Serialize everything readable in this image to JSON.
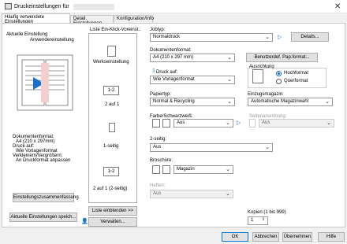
{
  "window": {
    "title": "Druckeinstellungen für"
  },
  "tabs": [
    "Häufig verwendete Einstellungen",
    "Detail. Einstellungen",
    "Konfiguration/Info"
  ],
  "left": {
    "current_label": "Aktuelle Einstellung",
    "current_name": "Anwendereinstellung",
    "summary": [
      "Dokumentenformat:",
      "A4 (210 x 297mm)",
      "Druck auf:",
      "Wie Vorlagenformat",
      "Verkleinern/Vergrößern:",
      "An Druckformat anpassen"
    ],
    "summary_button": "Einstellungszusammenfassung",
    "save_button": "Aktuelle Einstellungen speich..."
  },
  "oneclick": {
    "title": "Liste Ein-Klick-Voreinst.:",
    "items": [
      "Werkseinstellung",
      "2 auf 1",
      "1-seitig",
      "2 auf 1 (2-seitig)"
    ],
    "show_list": "Liste einblenden >>",
    "manage": "Verwalten..."
  },
  "settings": {
    "job_type": {
      "label": "Jobtyp:",
      "value": "Normaldruck",
      "details": "Details..."
    },
    "doc_size": {
      "label": "Dokumentenformat:",
      "value": "A4 (210 x 297 mm)",
      "custom": "Benutzerdef. Pap.format..."
    },
    "print_on": {
      "label": "Druck auf:",
      "value": "Wie Vorlagenformat"
    },
    "orientation": {
      "label": "Ausrichtung",
      "options": [
        "Hochformat",
        "Querformat"
      ],
      "selected": "Hochformat"
    },
    "paper_type": {
      "label": "Papiertyp:",
      "value": "Normal & Recycling"
    },
    "input_tray": {
      "label": "Einzugsmagazin:",
      "value": "Automatische Magazinwahl"
    },
    "color": {
      "label": "Farbe/Schwarzweiß:",
      "value": "Aus"
    },
    "page_order": {
      "label": "Seitenanordnung:",
      "value": "Aus"
    },
    "duplex": {
      "label": "2-seitig:",
      "value": "Aus"
    },
    "brochure": {
      "label": "Broschüre:",
      "value": "Magazin"
    },
    "staple": {
      "label": "Heften:",
      "value": "Aus"
    },
    "copies": {
      "label": "Kopien:(1 bis 999)",
      "value": "1"
    }
  },
  "footer": {
    "ok": "OK",
    "cancel": "Abbrechen",
    "apply": "Übernehmen",
    "help": "Hilfe"
  },
  "colors": {
    "accent": "#0078d7",
    "radio": "#1a6fc9"
  }
}
